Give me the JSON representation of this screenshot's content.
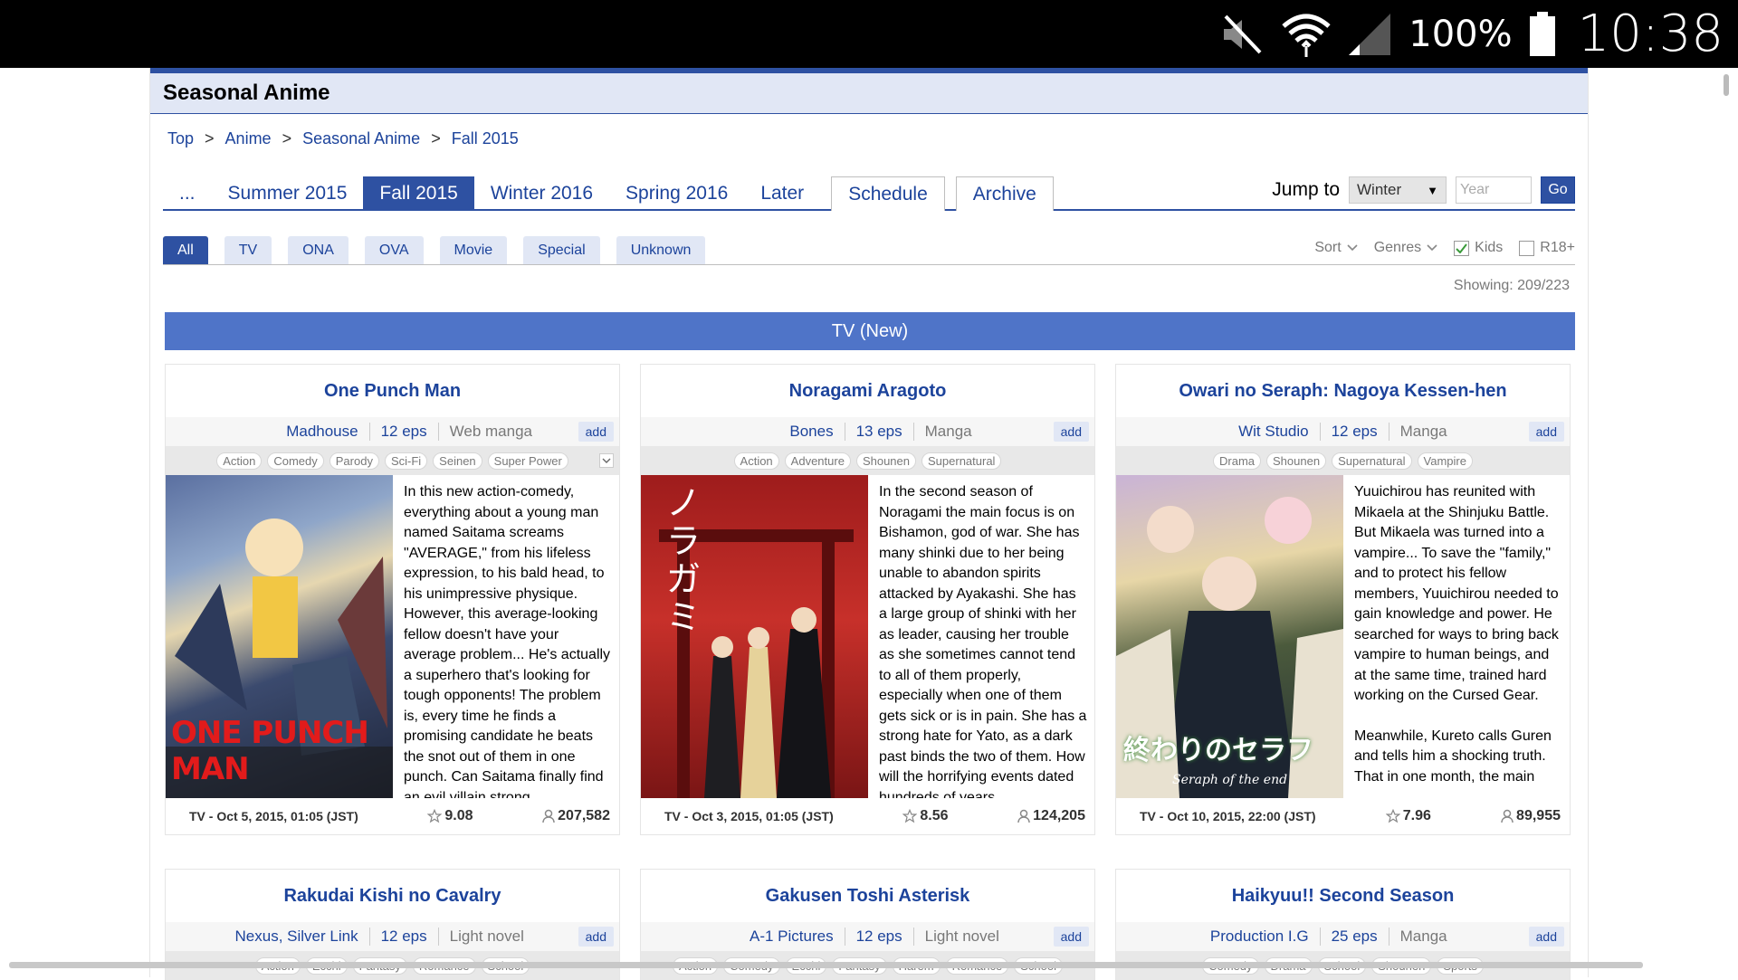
{
  "status_bar": {
    "battery": "100%",
    "time": "10:38",
    "icons": [
      "mute-icon",
      "wifi-icon",
      "signal-icon",
      "battery-icon"
    ]
  },
  "page": {
    "title": "Seasonal Anime"
  },
  "breadcrumb": [
    "Top",
    "Anime",
    "Seasonal Anime",
    "Fall 2015"
  ],
  "season_tabs": [
    "...",
    "Summer 2015",
    "Fall 2015",
    "Winter 2016",
    "Spring 2016",
    "Later"
  ],
  "extra_tabs": [
    "Schedule",
    "Archive"
  ],
  "jump": {
    "label": "Jump to",
    "season": "Winter",
    "year_placeholder": "Year",
    "go": "Go"
  },
  "types": [
    "All",
    "TV",
    "ONA",
    "OVA",
    "Movie",
    "Special",
    "Unknown"
  ],
  "filters": {
    "sort": "Sort",
    "genres": "Genres",
    "kids": "Kids",
    "r18": "R18+"
  },
  "showing": "Showing: 209/223",
  "section": "TV (New)",
  "add_label": "add",
  "cards": [
    {
      "title": "One Punch Man",
      "studio": "Madhouse",
      "eps": "12 eps",
      "source": "Web manga",
      "genres": [
        "Action",
        "Comedy",
        "Parody",
        "Sci-Fi",
        "Seinen",
        "Super Power"
      ],
      "poster_text": "ONE PUNCH MAN",
      "synopsis": "In this new action-comedy, everything about a young man named Saitama screams \"AVERAGE,\" from his lifeless expression, to his bald head, to his unimpressive physique. However, this average-looking fellow doesn't have your average problem... He's actually a superhero that's looking for tough opponents! The problem is, every time he finds a promising candidate he beats the snot out of them in one punch. Can Saitama finally find an evil villain strong",
      "date": "TV - Oct 5, 2015, 01:05 (JST)",
      "score": "9.08",
      "members": "207,582"
    },
    {
      "title": "Noragami Aragoto",
      "studio": "Bones",
      "eps": "13 eps",
      "source": "Manga",
      "genres": [
        "Action",
        "Adventure",
        "Shounen",
        "Supernatural"
      ],
      "poster_text": "ノラガミ",
      "synopsis": "In the second season of Noragami the main focus is on Bishamon, god of war. She has many shinki due to her being unable to abandon spirits attacked by Ayakashi. She has a large group of shinki with her as leader, causing her trouble as she sometimes cannot tend to all of them properly, especially when one of them gets sick or is in pain. She has a strong hate for Yato, as a dark past binds the two of them. How will the horrifying events dated hundreds of years",
      "date": "TV - Oct 3, 2015, 01:05 (JST)",
      "score": "8.56",
      "members": "124,205"
    },
    {
      "title": "Owari no Seraph: Nagoya Kessen-hen",
      "studio": "Wit Studio",
      "eps": "12 eps",
      "source": "Manga",
      "genres": [
        "Drama",
        "Shounen",
        "Supernatural",
        "Vampire"
      ],
      "poster_text": "終わりのセラフ",
      "poster_sub": "Seraph of the end",
      "synopsis": "Yuuichirou has reunited with Mikaela at the Shinjuku Battle. But Mikaela was turned into a vampire... To save the \"family,\" and to protect his fellow members, Yuuichirou needed to gain knowledge and power. He searched for ways to bring back vampire to human beings, and at the same time, trained hard working on the Cursed Gear.",
      "synopsis2": "Meanwhile, Kureto calls Guren and tells him a shocking truth. That in one month, the main",
      "date": "TV - Oct 10, 2015, 22:00 (JST)",
      "score": "7.96",
      "members": "89,955"
    }
  ],
  "cards_row2": [
    {
      "title": "Rakudai Kishi no Cavalry",
      "studio": "Nexus, Silver Link",
      "eps": "12 eps",
      "source": "Light novel",
      "genres": [
        "Action",
        "Ecchi",
        "Fantasy",
        "Romance",
        "School"
      ]
    },
    {
      "title": "Gakusen Toshi Asterisk",
      "studio": "A-1 Pictures",
      "eps": "12 eps",
      "source": "Light novel",
      "genres": [
        "Action",
        "Comedy",
        "Ecchi",
        "Fantasy",
        "Harem",
        "Romance",
        "School"
      ]
    },
    {
      "title": "Haikyuu!! Second Season",
      "studio": "Production I.G",
      "eps": "25 eps",
      "source": "Manga",
      "genres": [
        "Comedy",
        "Drama",
        "School",
        "Shounen",
        "Sports"
      ]
    }
  ],
  "colors": {
    "brand": "#2e51a2",
    "link": "#1c439b",
    "section": "#4f74c8",
    "header_bg": "#e1e7f5"
  }
}
